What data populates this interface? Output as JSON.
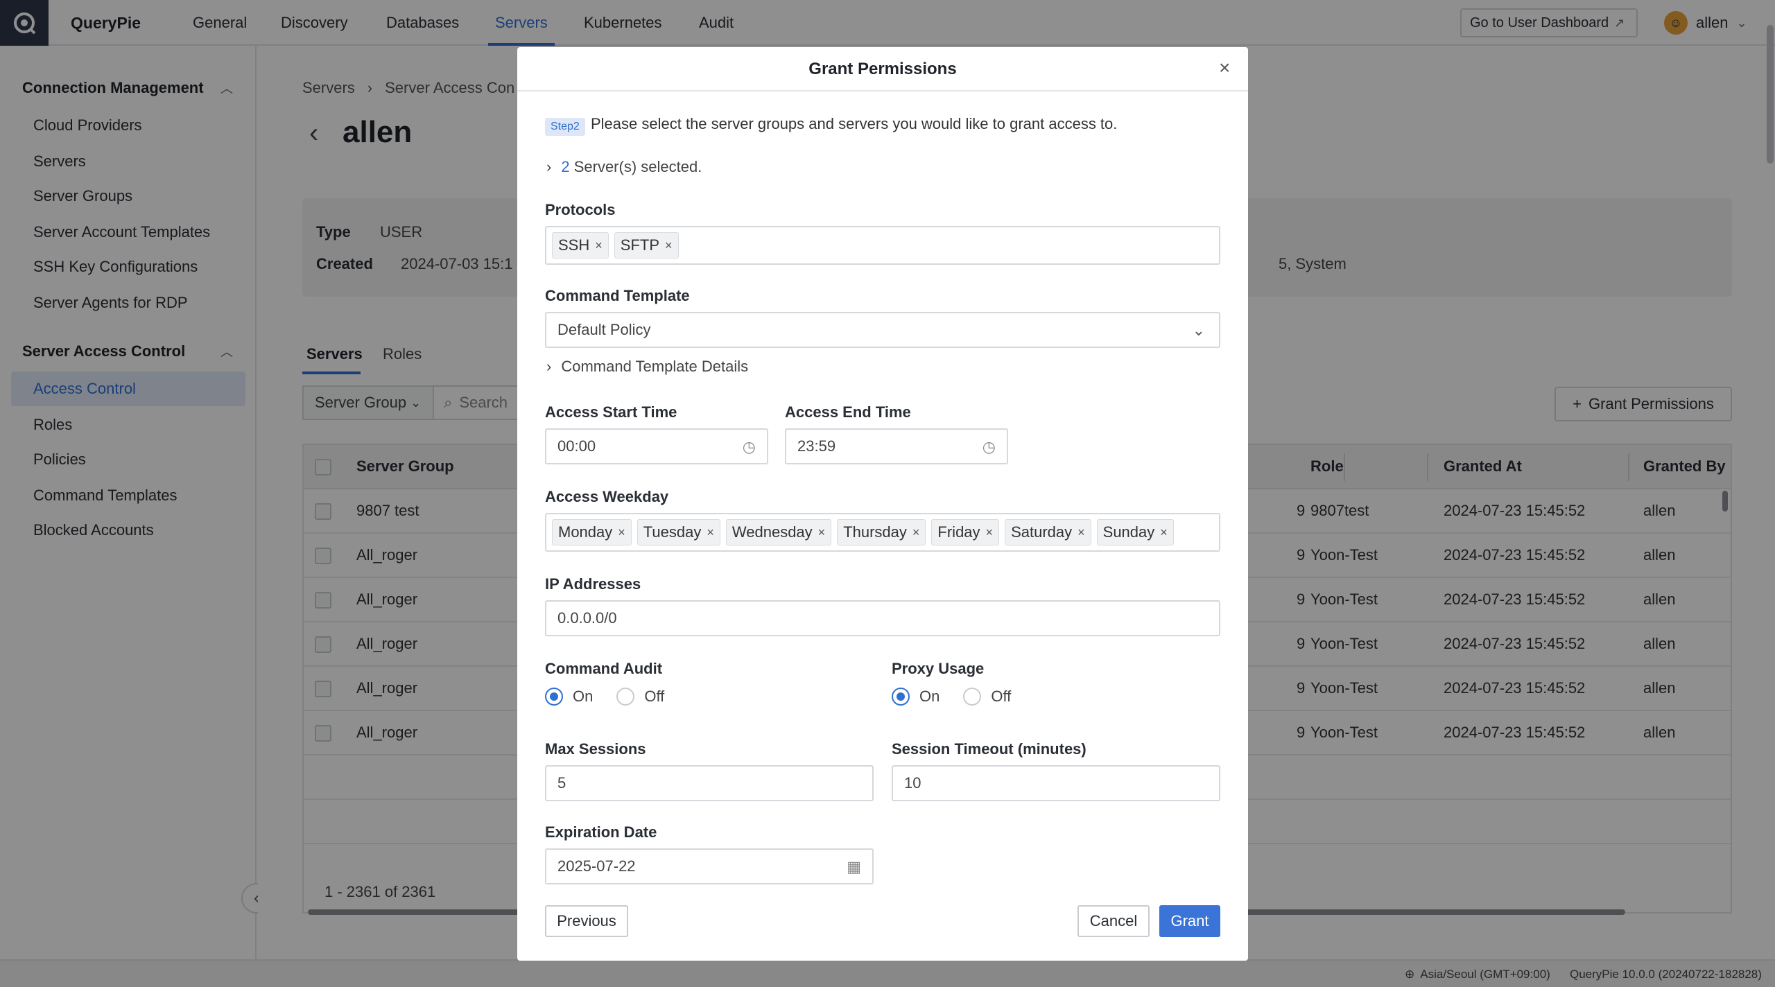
{
  "app": {
    "brand": "QueryPie"
  },
  "nav": {
    "items": [
      "General",
      "Discovery",
      "Databases",
      "Servers",
      "Kubernetes",
      "Audit"
    ],
    "active": "Servers",
    "dashboard_button": "Go to User Dashboard",
    "user": "allen"
  },
  "sidebar": {
    "section1": "Connection Management",
    "section1_items": [
      "Cloud Providers",
      "Servers",
      "Server Groups",
      "Server Account Templates",
      "SSH Key Configurations",
      "Server Agents for RDP"
    ],
    "section2": "Server Access Control",
    "section2_items": [
      "Access Control",
      "Roles",
      "Policies",
      "Command Templates",
      "Blocked Accounts"
    ],
    "active_item": "Access Control"
  },
  "main": {
    "breadcrumb": [
      "Servers",
      "Server Access Con"
    ],
    "title": "allen",
    "info": {
      "type_label": "Type",
      "type_value": "USER",
      "created_label": "Created",
      "created_value": "2024-07-03 15:1",
      "right_value": "5, System"
    },
    "tabs": [
      "Servers",
      "Roles"
    ],
    "filter_label": "Server Group",
    "search_placeholder": "Search",
    "grant_button": "Grant Permissions",
    "table": {
      "headers": {
        "server_group": "Server Group",
        "role": "Role",
        "granted_at": "Granted At",
        "granted_by": "Granted By"
      },
      "rows": [
        {
          "server_group": "9807 test",
          "partial": "9",
          "role": "9807test",
          "granted_at": "2024-07-23 15:45:52",
          "granted_by": "allen"
        },
        {
          "server_group": "All_roger",
          "partial": "9",
          "role": "Yoon-Test",
          "granted_at": "2024-07-23 15:45:52",
          "granted_by": "allen"
        },
        {
          "server_group": "All_roger",
          "partial": "9",
          "role": "Yoon-Test",
          "granted_at": "2024-07-23 15:45:52",
          "granted_by": "allen"
        },
        {
          "server_group": "All_roger",
          "partial": "9",
          "role": "Yoon-Test",
          "granted_at": "2024-07-23 15:45:52",
          "granted_by": "allen"
        },
        {
          "server_group": "All_roger",
          "partial": "9",
          "role": "Yoon-Test",
          "granted_at": "2024-07-23 15:45:52",
          "granted_by": "allen"
        },
        {
          "server_group": "All_roger",
          "partial": "9",
          "role": "Yoon-Test",
          "granted_at": "2024-07-23 15:45:52",
          "granted_by": "allen"
        }
      ]
    },
    "pager": "1 - 2361 of 2361"
  },
  "status": {
    "timezone": "Asia/Seoul (GMT+09:00)",
    "version": "QueryPie 10.0.0 (20240722-182828)"
  },
  "modal": {
    "title": "Grant Permissions",
    "step_badge": "Step2",
    "step_text": "Please select the server groups and servers you would like to grant access to.",
    "selected_count": "2",
    "selected_text": "Server(s) selected.",
    "protocols_label": "Protocols",
    "protocols": [
      "SSH",
      "SFTP"
    ],
    "command_template_label": "Command Template",
    "command_template_value": "Default Policy",
    "command_template_details": "Command Template Details",
    "access_start_label": "Access Start Time",
    "access_start_value": "00:00",
    "access_end_label": "Access End Time",
    "access_end_value": "23:59",
    "weekday_label": "Access Weekday",
    "weekdays": [
      "Monday",
      "Tuesday",
      "Wednesday",
      "Thursday",
      "Friday",
      "Saturday",
      "Sunday"
    ],
    "ip_label": "IP Addresses",
    "ip_value": "0.0.0.0/0",
    "command_audit_label": "Command Audit",
    "proxy_usage_label": "Proxy Usage",
    "on_label": "On",
    "off_label": "Off",
    "command_audit_value": "On",
    "proxy_usage_value": "On",
    "max_sessions_label": "Max Sessions",
    "max_sessions_value": "5",
    "session_timeout_label": "Session Timeout (minutes)",
    "session_timeout_value": "10",
    "expiration_label": "Expiration Date",
    "expiration_value": "2025-07-22",
    "previous_button": "Previous",
    "cancel_button": "Cancel",
    "grant_button": "Grant"
  },
  "colors": {
    "accent": "#2f6fd1",
    "primary_button": "#3a74d6",
    "logo_bg": "#2d3648"
  }
}
